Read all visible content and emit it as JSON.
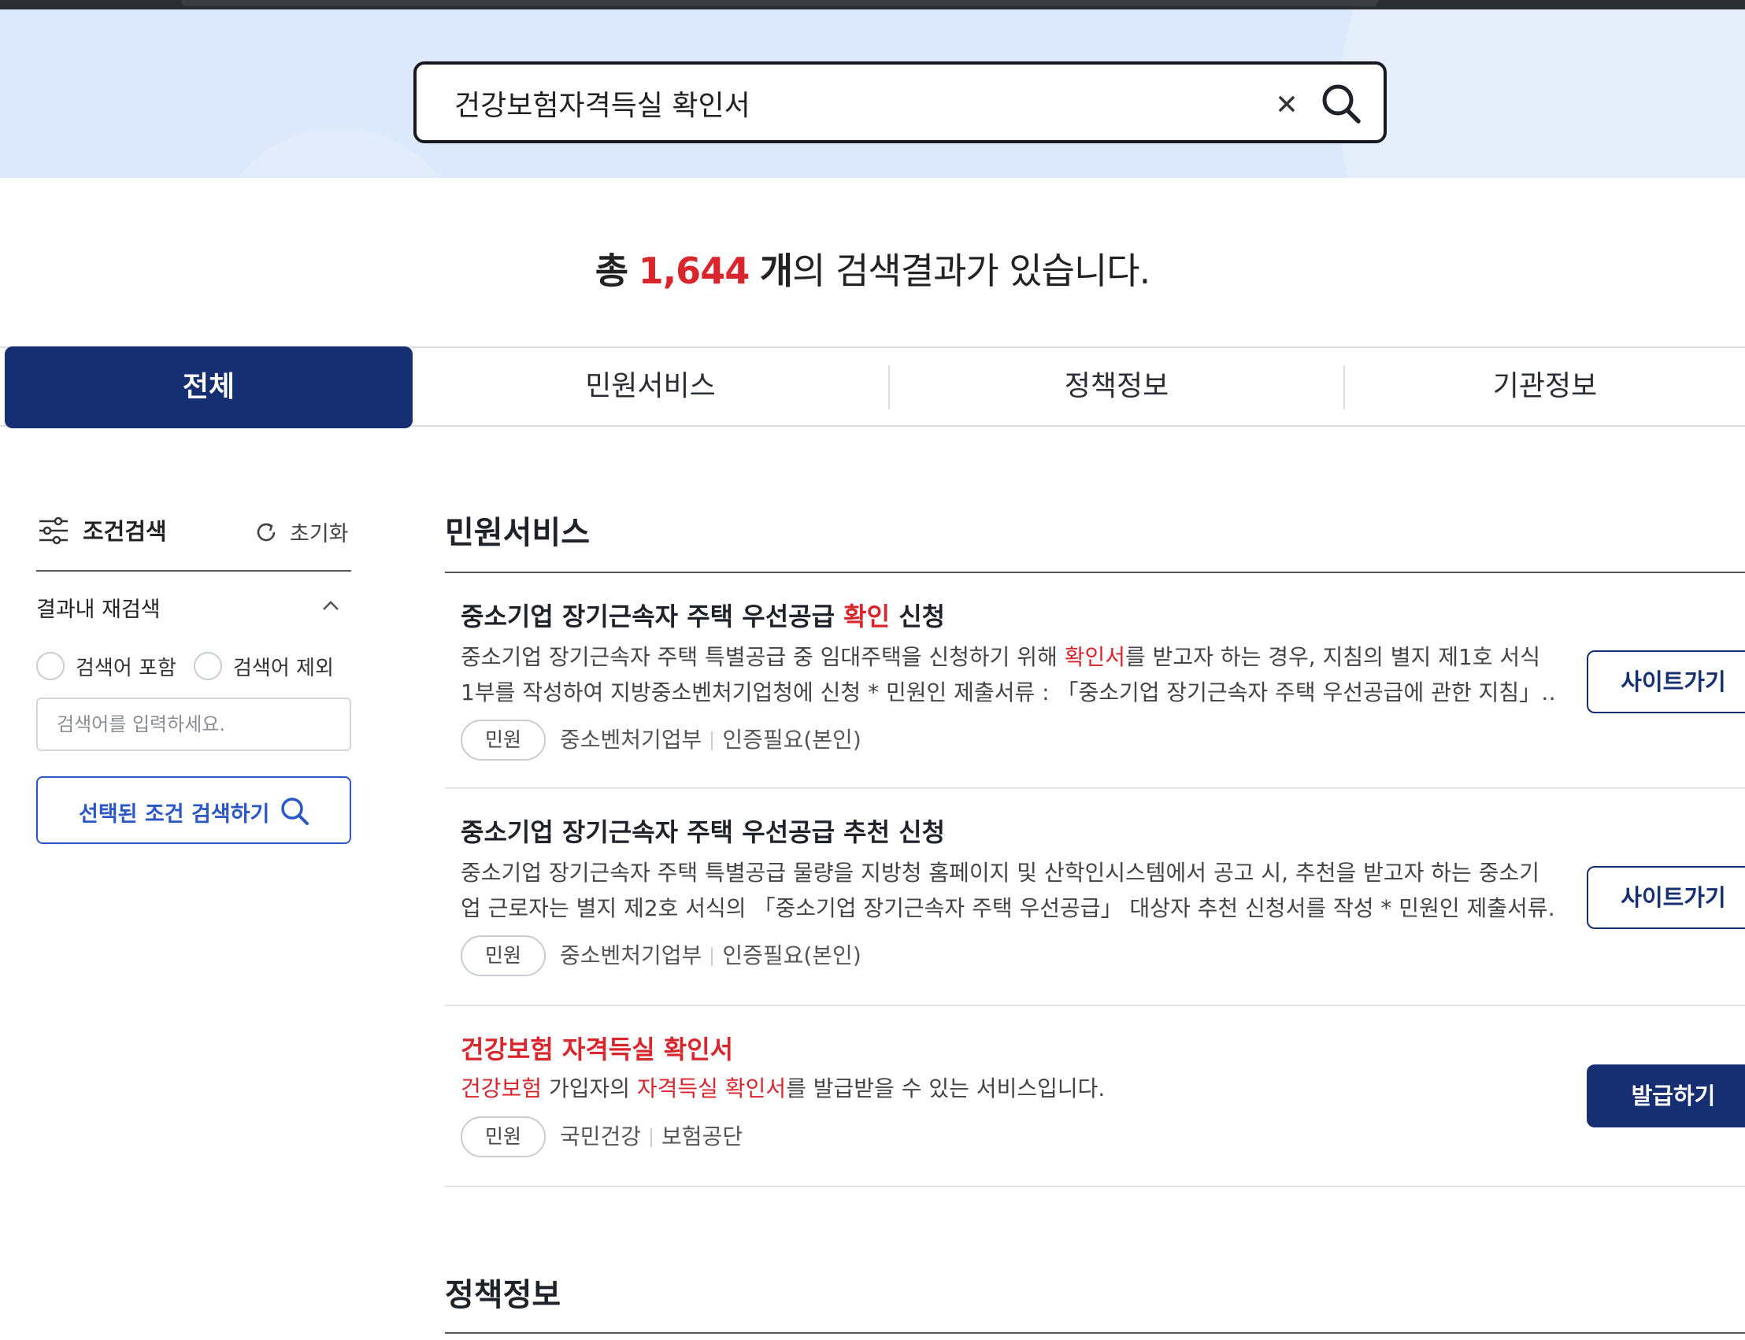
{
  "search": {
    "query": "건강보험자격득실 확인서"
  },
  "summary": {
    "prefix": "총",
    "count": "1,644",
    "unit": "개",
    "suffix": "의 검색결과가 있습니다."
  },
  "tabs": [
    {
      "label": "전체",
      "active": true
    },
    {
      "label": "민원서비스",
      "active": false
    },
    {
      "label": "정책정보",
      "active": false
    },
    {
      "label": "기관정보",
      "active": false
    }
  ],
  "sidebar": {
    "title": "조건검색",
    "reset_label": "초기화",
    "refine_title": "결과내 재검색",
    "include_label": "검색어 포함",
    "exclude_label": "검색어 제외",
    "input_placeholder": "검색어를 입력하세요.",
    "search_button_label": "선택된 조건 검색하기"
  },
  "sections": {
    "civil_title": "민원서비스",
    "policy_title": "정책정보"
  },
  "results": [
    {
      "title_pre": "중소기업 장기근속자 주택 우선공급 ",
      "title_hl": "확인",
      "title_post": " 신청",
      "desc_line1_pre": "중소기업 장기근속자 주택 특별공급 중 임대주택을 신청하기 위해 ",
      "desc_line1_hl": "확인서",
      "desc_line1_post": "를 받고자 하는 경우, 지침의 별지 제1호 서식",
      "desc_line2": "1부를 작성하여 지방중소벤처기업청에 신청 * 민원인 제출서류 : 「중소기업 장기근속자 주택 우선공급에 관한 지침」…",
      "badge": "민원",
      "agency": "중소벤처기업부",
      "auth": "인증필요(본인)",
      "button": "사이트가기"
    },
    {
      "title": "중소기업 장기근속자 주택 우선공급 추천 신청",
      "desc_line1": "중소기업 장기근속자 주택 특별공급 물량을 지방청 홈페이지 및 산학인시스템에서 공고 시, 추천을 받고자 하는 중소기",
      "desc_line2": "업 근로자는 별지 제2호 서식의 「중소기업 장기근속자 주택 우선공급」 대상자 추천 신청서를 작성 * 민원인 제출서류…",
      "badge": "민원",
      "agency": "중소벤처기업부",
      "auth": "인증필요(본인)",
      "button": "사이트가기"
    },
    {
      "title": "건강보험 자격득실 확인서",
      "desc_hl1": "건강보험",
      "desc_mid1": " 가입자의 ",
      "desc_hl2": "자격득실 확인서",
      "desc_post": "를 발급받을 수 있는 서비스입니다.",
      "badge": "민원",
      "agency_part1": "국민건강",
      "agency_part2": "보험공단",
      "button": "발급하기"
    }
  ],
  "colors": {
    "primary_navy": "#162f73",
    "highlight_red": "#d8262c",
    "hero_bg": "#dce8fb",
    "accent_blue": "#2a56c6"
  },
  "icons": [
    "close-icon",
    "search-icon",
    "filter-sliders-icon",
    "reset-refresh-icon",
    "chevron-up-icon"
  ]
}
